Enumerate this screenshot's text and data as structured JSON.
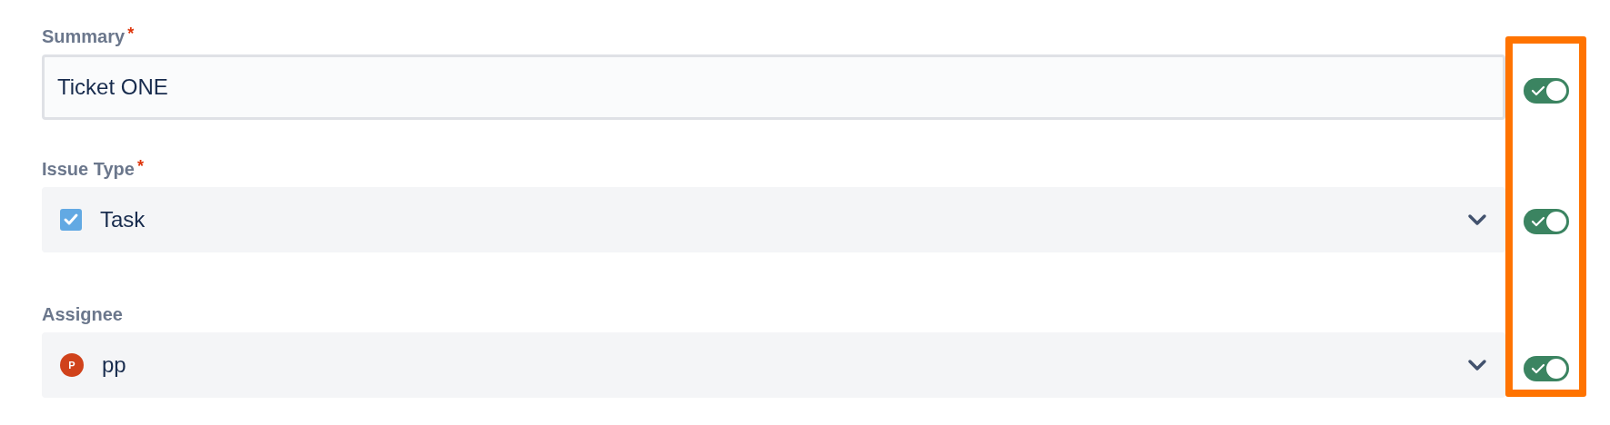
{
  "fields": [
    {
      "label": "Summary",
      "required_mark": "*",
      "kind": "text",
      "value": "Ticket ONE",
      "toggle_on": true
    },
    {
      "label": "Issue Type",
      "required_mark": "*",
      "kind": "select",
      "lead": {
        "kind": "task"
      },
      "value": "Task",
      "toggle_on": true
    },
    {
      "label": "Assignee",
      "kind": "select",
      "lead": {
        "kind": "avatar",
        "text": "P"
      },
      "value": "pp",
      "toggle_on": true
    }
  ]
}
